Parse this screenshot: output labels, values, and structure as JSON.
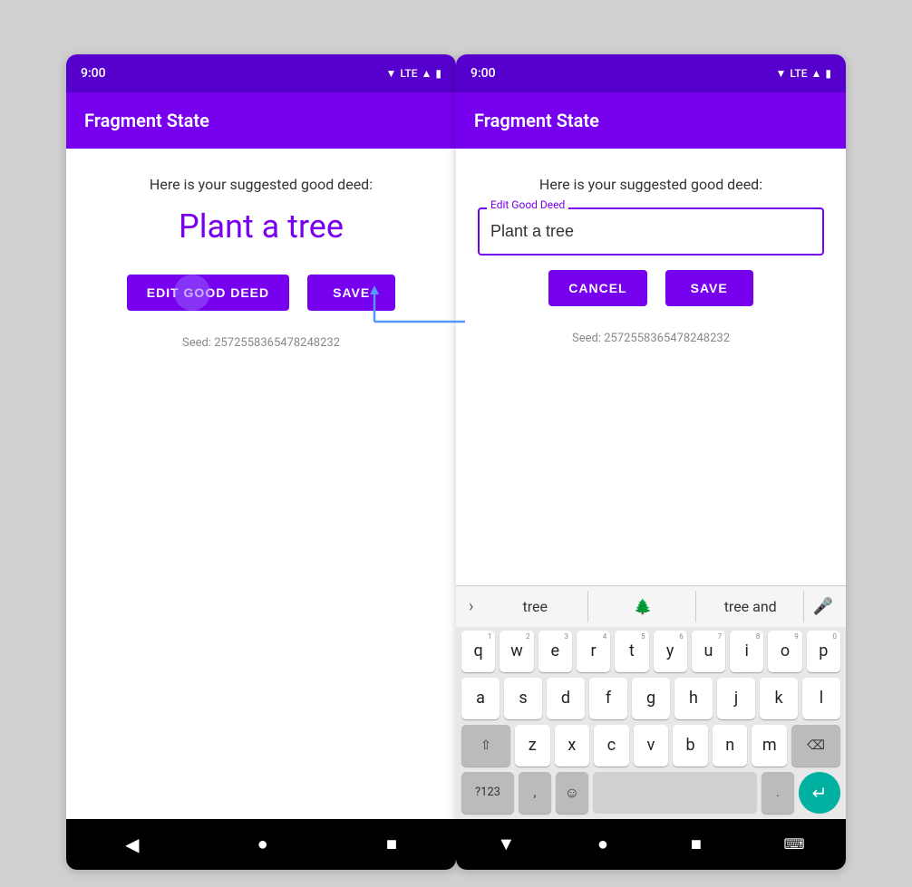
{
  "left_phone": {
    "status_time": "9:00",
    "status_lte": "LTE",
    "app_title": "Fragment State",
    "suggested_label": "Here is your suggested good deed:",
    "good_deed": "Plant a tree",
    "btn_edit_label": "EDIT GOOD DEED",
    "btn_save_label": "SAVE",
    "seed_text": "Seed: 2572558365478248232"
  },
  "right_phone": {
    "status_time": "9:00",
    "status_lte": "LTE",
    "app_title": "Fragment State",
    "suggested_label": "Here is your suggested good deed:",
    "edit_field_label": "Edit Good Deed",
    "edit_field_value": "Plant a tree",
    "btn_cancel_label": "CANCEL",
    "btn_save_label": "SAVE",
    "seed_text": "Seed: 2572558365478248232",
    "keyboard": {
      "suggestions": [
        "tree",
        "🌲",
        "tree and"
      ],
      "row1": [
        "q",
        "w",
        "e",
        "r",
        "t",
        "y",
        "u",
        "i",
        "o",
        "p"
      ],
      "row1_nums": [
        "1",
        "2",
        "3",
        "4",
        "5",
        "6",
        "7",
        "8",
        "9",
        "0"
      ],
      "row2": [
        "a",
        "s",
        "d",
        "f",
        "g",
        "h",
        "j",
        "k",
        "l"
      ],
      "row3": [
        "z",
        "x",
        "c",
        "v",
        "b",
        "n",
        "m"
      ],
      "special_left": "?123",
      "special_comma": ",",
      "special_period": ".",
      "shift_label": "⇧",
      "backspace_label": "⌫",
      "emoji_label": "☺"
    }
  }
}
